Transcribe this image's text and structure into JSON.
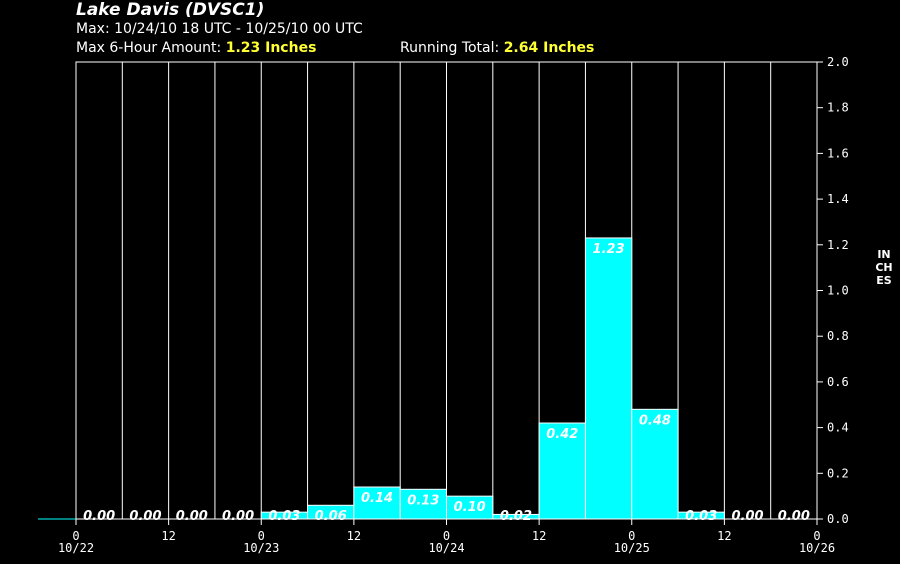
{
  "header": {
    "title": "Lake Davis (DVSC1)",
    "max_period": "Max: 10/24/10 18 UTC - 10/25/10 00 UTC",
    "max_amount_label": "Max 6-Hour Amount:",
    "max_amount_value": "1.23 Inches",
    "running_total_label": "Running Total:",
    "running_total_value": "2.64 Inches"
  },
  "chart_data": {
    "type": "bar",
    "title": "Lake Davis (DVSC1)",
    "ylabel": "INCHES",
    "ylim": [
      0,
      2.0
    ],
    "yticks": [
      "0.0",
      "0.2",
      "0.4",
      "0.6",
      "0.8",
      "1.0",
      "1.2",
      "1.4",
      "1.6",
      "1.8",
      "2.0"
    ],
    "xlim": [
      0,
      16
    ],
    "xticks": [
      {
        "hour": "0",
        "date": "10/22"
      },
      {
        "hour": "12",
        "date": ""
      },
      {
        "hour": "0",
        "date": "10/23"
      },
      {
        "hour": "12",
        "date": ""
      },
      {
        "hour": "0",
        "date": "10/24"
      },
      {
        "hour": "12",
        "date": ""
      },
      {
        "hour": "0",
        "date": "10/25"
      },
      {
        "hour": "12",
        "date": ""
      },
      {
        "hour": "0",
        "date": "10/26"
      }
    ],
    "values": [
      0.0,
      0.0,
      0.0,
      0.0,
      0.03,
      0.06,
      0.14,
      0.13,
      0.1,
      0.02,
      0.42,
      1.23,
      0.48,
      0.03,
      0.0,
      0.0
    ],
    "labels": [
      "0.00",
      "0.00",
      "0.00",
      "0.00",
      "0.03",
      "0.06",
      "0.14",
      "0.13",
      "0.10",
      "0.02",
      "0.42",
      "1.23",
      "0.48",
      "0.03",
      "0.00",
      "0.00"
    ],
    "colors": {
      "bar": "#00ffff",
      "grid": "#ffffff",
      "background": "#000000",
      "highlight": "#ffff33"
    }
  }
}
